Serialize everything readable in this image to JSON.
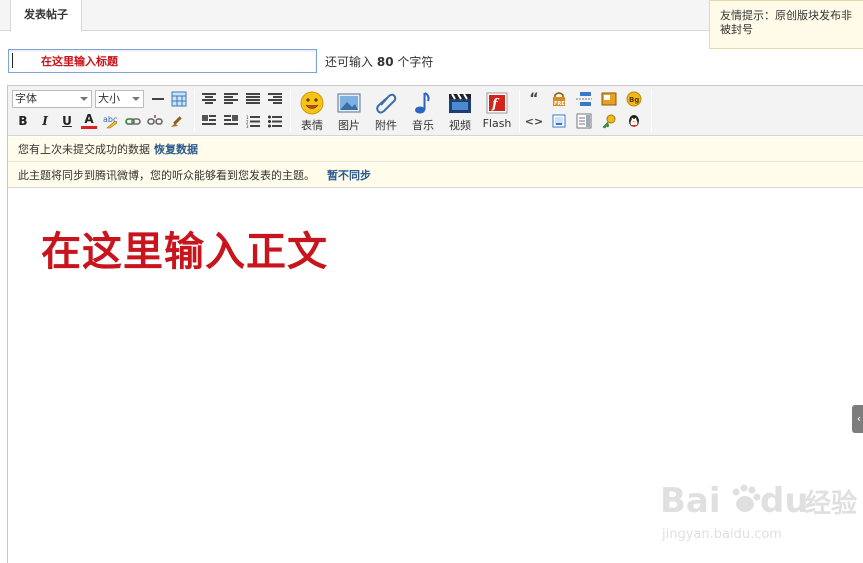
{
  "tabs": {
    "active_label": "发表帖子"
  },
  "tip": {
    "line1": "友情提示：原创版块发布非",
    "line2": "被封号"
  },
  "title_row": {
    "title_placeholder": "在这里输入标题",
    "count_prefix": "还可输入",
    "count_value": "80",
    "count_suffix": "个字符"
  },
  "toolbar": {
    "font_select": "字体",
    "size_select": "大小",
    "buttons": {
      "emoji": "表情",
      "image": "图片",
      "attachment": "附件",
      "music": "音乐",
      "video": "视频",
      "flash": "Flash"
    },
    "format_letters": {
      "bold": "B",
      "italic": "I",
      "underline": "U",
      "color": "A",
      "code": "<>",
      "quote": "“"
    }
  },
  "notices": {
    "restore_text": "您有上次未提交成功的数据",
    "restore_link": "恢复数据",
    "sync_text": "此主题将同步到腾讯微博，您的听众能够看到您发表的主题。",
    "sync_link": "暂不同步"
  },
  "body": {
    "placeholder_text": "在这里输入正文"
  },
  "watermark": {
    "brand": "Bai",
    "brand2": "du",
    "sub": "经验",
    "url": "jingyan.baidu.com"
  },
  "colors": {
    "accent_red": "#c8141c",
    "link_blue": "#2b5a8f",
    "notice_bg": "#fffceb",
    "toolbar_bg": "#f3f3f3"
  }
}
